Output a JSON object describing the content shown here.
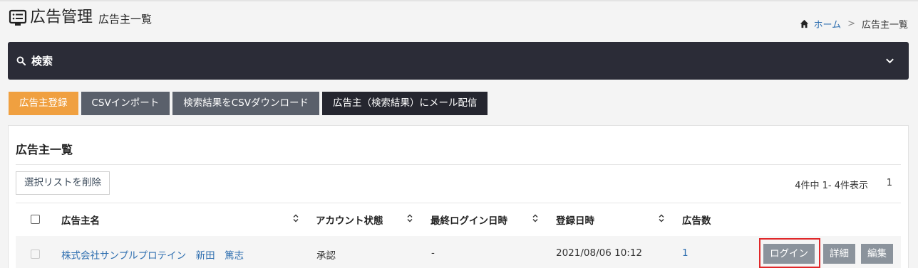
{
  "header": {
    "title": "広告管理",
    "subtitle": "広告主一覧"
  },
  "breadcrumb": {
    "home": "ホーム",
    "separator": ">",
    "current": "広告主一覧"
  },
  "search": {
    "label": "検索"
  },
  "toolbar": {
    "register": "広告主登録",
    "csv_import": "CSVインポート",
    "csv_download": "検索結果をCSVダウンロード",
    "mail": "広告主（検索結果）にメール配信"
  },
  "list": {
    "title": "広告主一覧",
    "delete_selected": "選択リストを削除",
    "count": "4件中 1- 4件表示",
    "page": "1",
    "columns": {
      "name": "広告主名",
      "status": "アカウント状態",
      "last_login": "最終ログイン日時",
      "registered": "登録日時",
      "ads": "広告数"
    },
    "rows": [
      {
        "name": "株式会社サンプルプロテイン　新田　篤志",
        "status": "承認",
        "last_login": "-",
        "registered": "2021/08/06 10:12",
        "ads": "1",
        "login": "ログイン",
        "detail": "詳細",
        "edit": "編集"
      }
    ]
  },
  "colors": {
    "accent": "#f0a040",
    "dark": "#2b2c37",
    "link": "#2f6fb0",
    "highlight": "#e0282a"
  },
  "icons": [
    "list-icon",
    "home-icon",
    "search-icon",
    "chevron-down-icon",
    "sort-icon"
  ]
}
